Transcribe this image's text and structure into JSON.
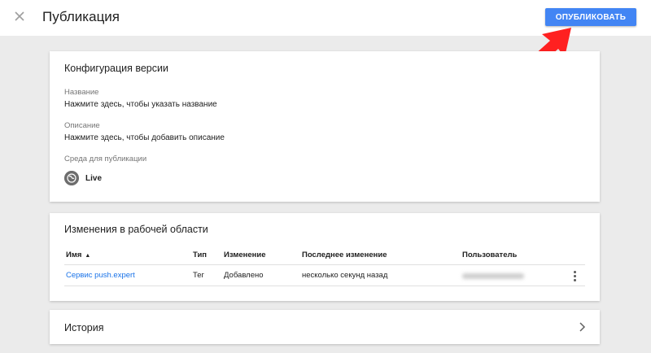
{
  "header": {
    "title": "Публикация",
    "close_icon": "close-icon",
    "publish_label": "ОПУБЛИКОВАТЬ"
  },
  "config": {
    "title": "Конфигурация версии",
    "name_label": "Название",
    "name_placeholder": "Нажмите здесь, чтобы указать название",
    "desc_label": "Описание",
    "desc_placeholder": "Нажмите здесь, чтобы добавить описание",
    "env_label": "Среда для публикации",
    "env_name": "Live",
    "env_icon": "globe-icon"
  },
  "changes": {
    "title": "Изменения в рабочей области",
    "columns": {
      "name": "Имя",
      "type": "Тип",
      "change": "Изменение",
      "last_change": "Последнее изменение",
      "user": "Пользователь"
    },
    "rows": [
      {
        "name": "Сервис push.expert",
        "type": "Тег",
        "change": "Добавлено",
        "last_change": "несколько секунд назад",
        "user": ""
      }
    ]
  },
  "history": {
    "title": "История"
  },
  "colors": {
    "accent": "#4285f4",
    "link": "#1a73e8",
    "annotation_arrow": "#ff2020"
  }
}
